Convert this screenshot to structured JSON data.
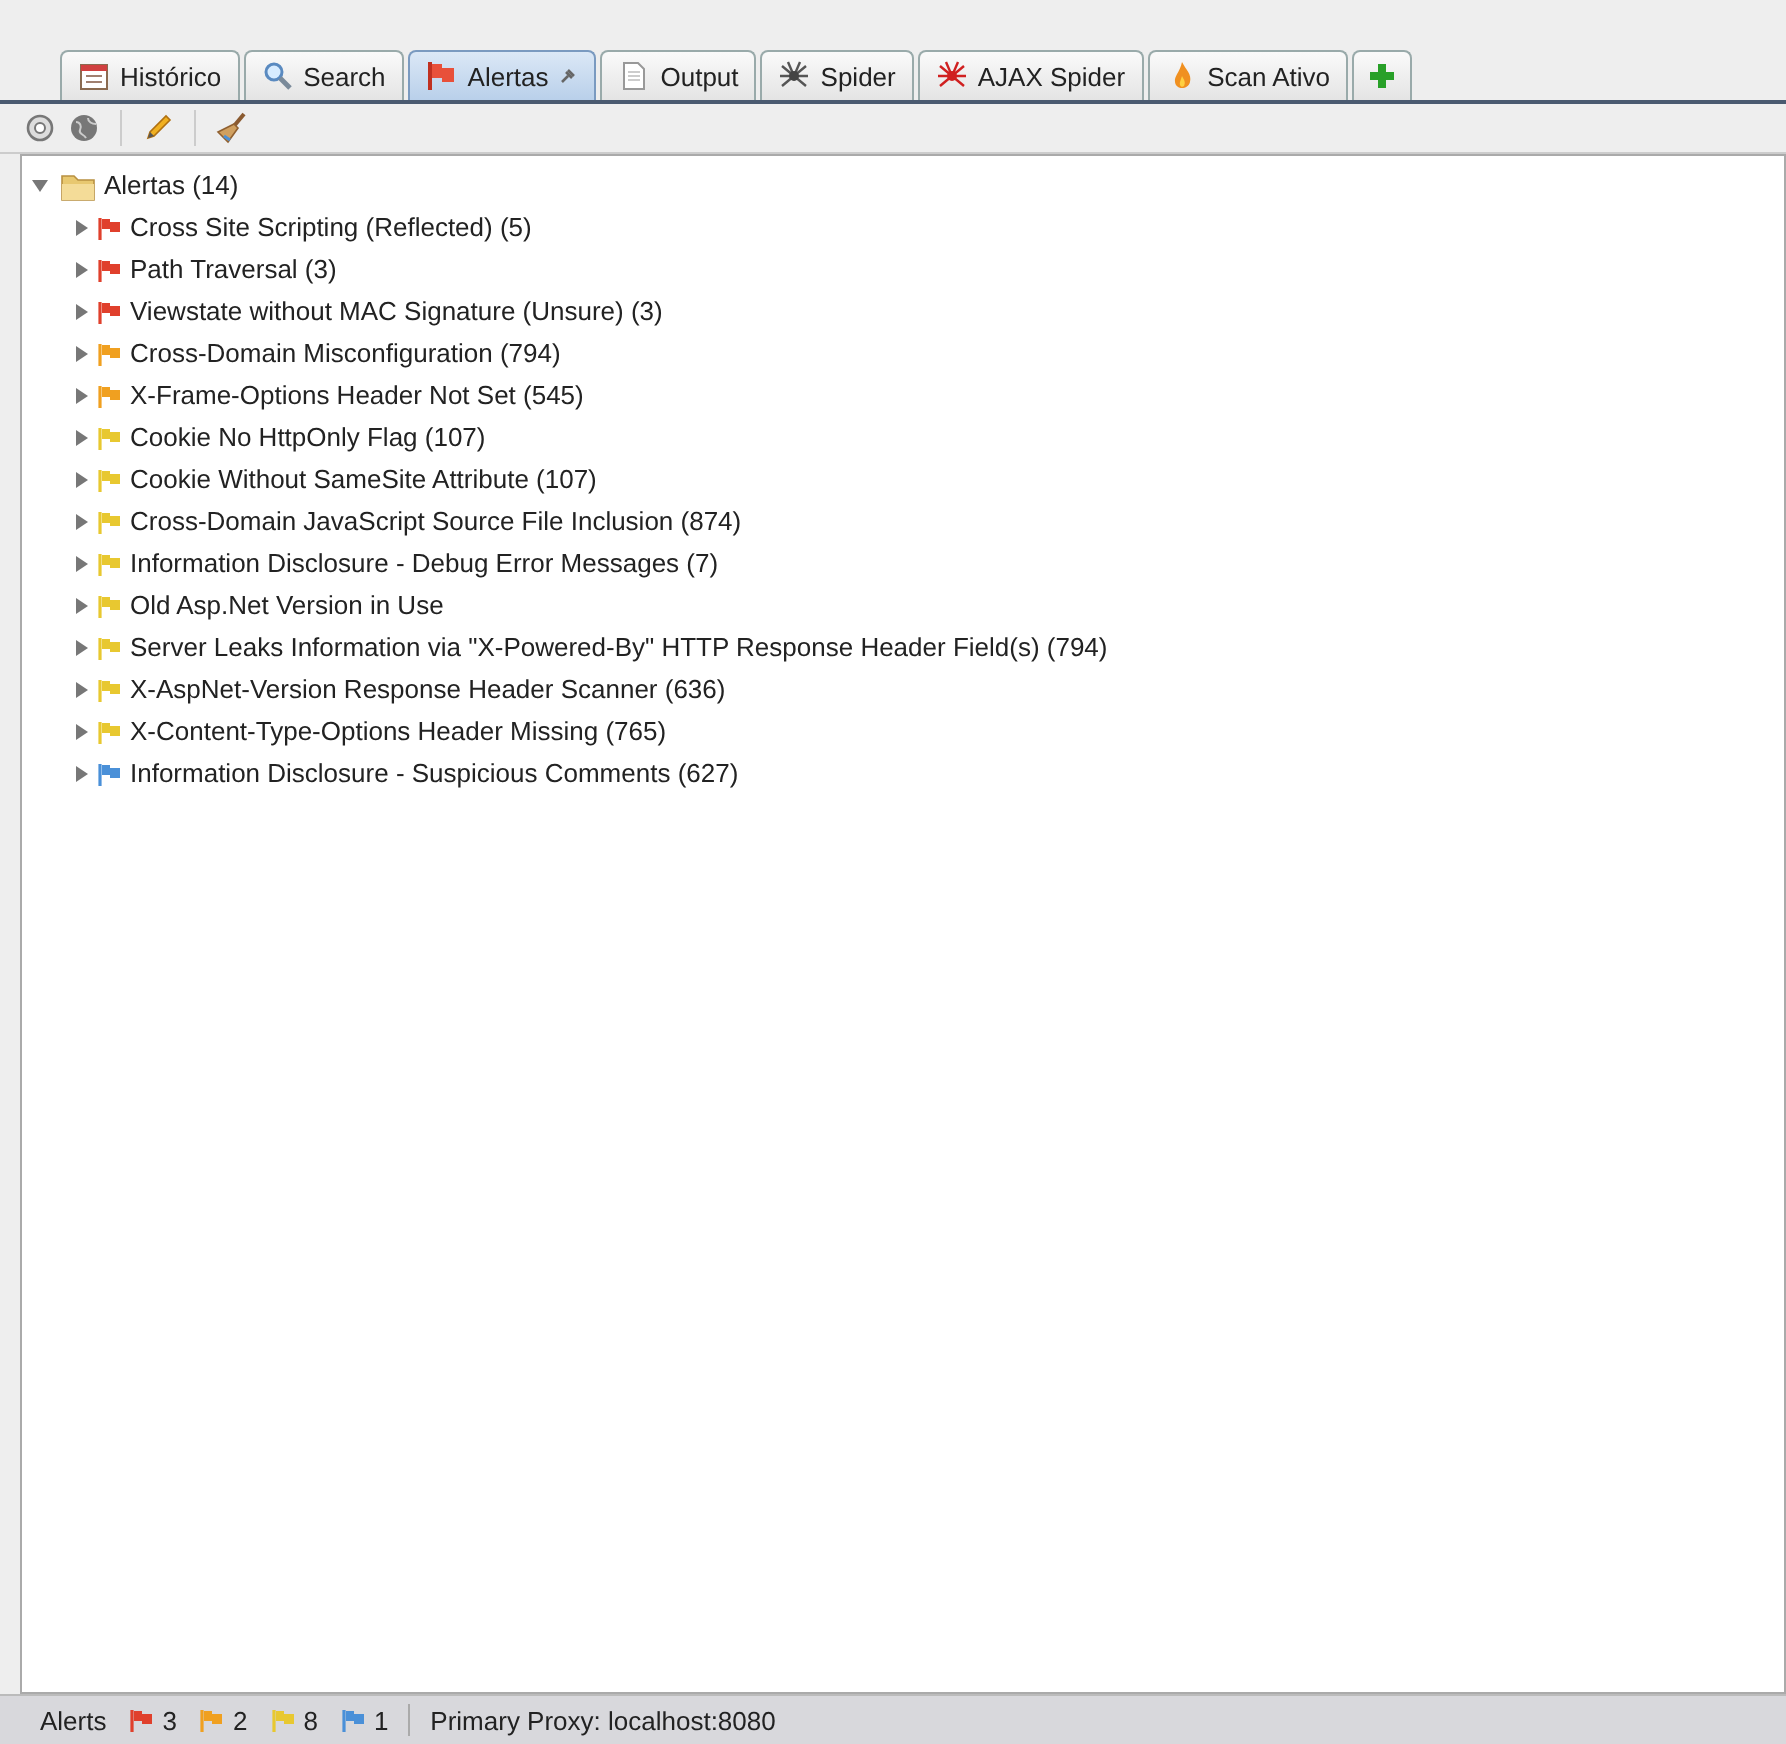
{
  "tabs": [
    {
      "label": "Histórico",
      "selected": false
    },
    {
      "label": "Search",
      "selected": false
    },
    {
      "label": "Alertas",
      "selected": true
    },
    {
      "label": "Output",
      "selected": false
    },
    {
      "label": "Spider",
      "selected": false
    },
    {
      "label": "AJAX Spider",
      "selected": false
    },
    {
      "label": "Scan Ativo",
      "selected": false
    }
  ],
  "tree": {
    "label": "Alertas (14)",
    "expanded": true,
    "children": [
      {
        "label": "Cross Site Scripting (Reflected) (5)",
        "color": "#e0402c",
        "expanded": false
      },
      {
        "label": "Path Traversal (3)",
        "color": "#e0402c",
        "expanded": false
      },
      {
        "label": "Viewstate without MAC Signature (Unsure) (3)",
        "color": "#e0402c",
        "expanded": false
      },
      {
        "label": "Cross-Domain Misconfiguration (794)",
        "color": "#f0a020",
        "expanded": false
      },
      {
        "label": "X-Frame-Options Header Not Set (545)",
        "color": "#f0a020",
        "expanded": false
      },
      {
        "label": "Cookie No HttpOnly Flag (107)",
        "color": "#e8c830",
        "expanded": false
      },
      {
        "label": "Cookie Without SameSite Attribute (107)",
        "color": "#e8c830",
        "expanded": false
      },
      {
        "label": "Cross-Domain JavaScript Source File Inclusion (874)",
        "color": "#e8c830",
        "expanded": false
      },
      {
        "label": "Information Disclosure - Debug Error Messages (7)",
        "color": "#e8c830",
        "expanded": false
      },
      {
        "label": "Old Asp.Net Version in Use",
        "color": "#e8c830",
        "expanded": false
      },
      {
        "label": "Server Leaks Information via \"X-Powered-By\" HTTP Response Header Field(s) (794)",
        "color": "#e8c830",
        "expanded": false
      },
      {
        "label": "X-AspNet-Version Response Header Scanner (636)",
        "color": "#e8c830",
        "expanded": false
      },
      {
        "label": "X-Content-Type-Options Header Missing (765)",
        "color": "#e8c830",
        "expanded": false
      },
      {
        "label": "Information Disclosure - Suspicious Comments (627)",
        "color": "#4a90d8",
        "expanded": false
      }
    ]
  },
  "status_bar": {
    "label": "Alerts",
    "counts": [
      {
        "count": "3",
        "color": "#e0402c"
      },
      {
        "count": "2",
        "color": "#f0a020"
      },
      {
        "count": "8",
        "color": "#e8c830"
      },
      {
        "count": "1",
        "color": "#4a90d8"
      }
    ],
    "proxy": "Primary Proxy: localhost:8080"
  }
}
